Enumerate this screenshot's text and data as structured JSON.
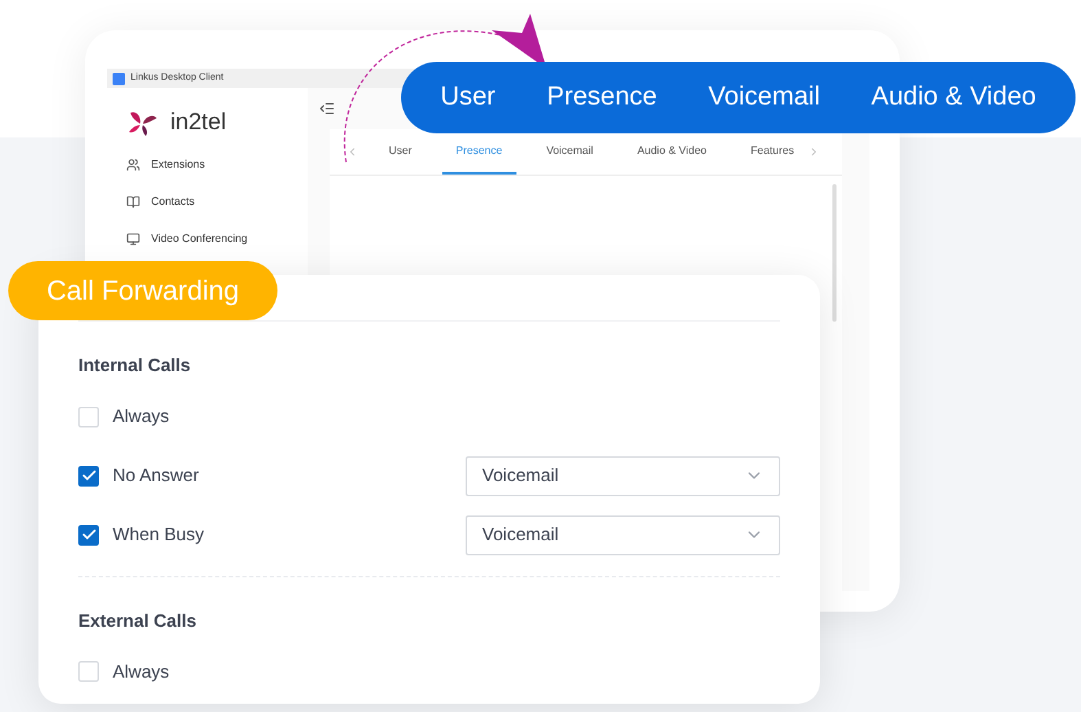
{
  "window": {
    "title": "Linkus Desktop Client"
  },
  "sidebar": {
    "logo": "in2tel",
    "items": [
      {
        "label": "Extensions"
      },
      {
        "label": "Contacts"
      },
      {
        "label": "Video Conferencing"
      }
    ]
  },
  "tabs": [
    {
      "label": "User",
      "selected": false
    },
    {
      "label": "Presence",
      "selected": true
    },
    {
      "label": "Voicemail",
      "selected": false
    },
    {
      "label": "Audio & Video",
      "selected": false
    },
    {
      "label": "Features",
      "selected": false
    }
  ],
  "callout_tabs": [
    "User",
    "Presence",
    "Voicemail",
    "Audio & Video"
  ],
  "call_forwarding": {
    "title": "Call Forwarding",
    "sections": [
      {
        "heading": "Internal Calls",
        "rows": [
          {
            "label": "Always",
            "checked": false
          },
          {
            "label": "No Answer",
            "checked": true,
            "select": "Voicemail"
          },
          {
            "label": "When Busy",
            "checked": true,
            "select": "Voicemail"
          }
        ]
      },
      {
        "heading": "External Calls",
        "rows": [
          {
            "label": "Always",
            "checked": false
          }
        ]
      }
    ]
  }
}
